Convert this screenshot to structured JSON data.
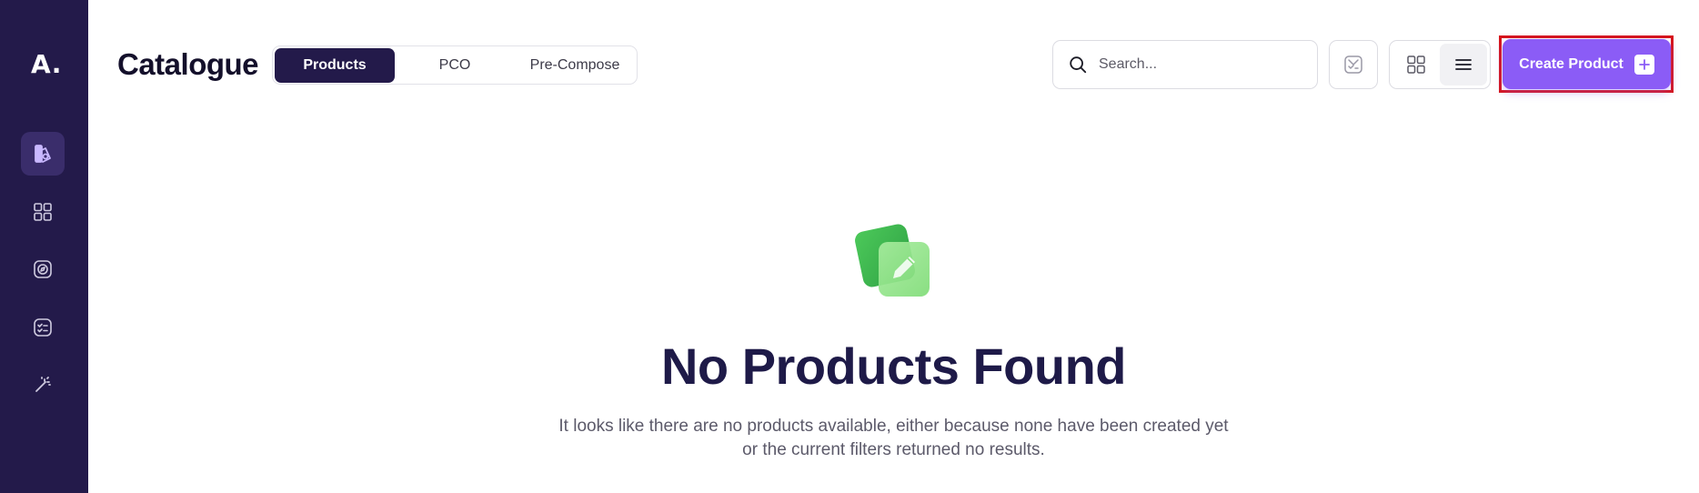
{
  "app": {
    "logo_text": "A."
  },
  "sidebar": {
    "items": [
      {
        "icon": "catalogue-icon",
        "active": true
      },
      {
        "icon": "grid-icon",
        "active": false
      },
      {
        "icon": "compass-icon",
        "active": false
      },
      {
        "icon": "checklist-icon",
        "active": false
      },
      {
        "icon": "magic-wand-icon",
        "active": false
      }
    ]
  },
  "header": {
    "title": "Catalogue",
    "tabs": [
      {
        "label": "Products",
        "active": true
      },
      {
        "label": "PCO",
        "active": false
      },
      {
        "label": "Pre-Compose",
        "active": false
      }
    ],
    "search": {
      "placeholder": "Search...",
      "value": ""
    },
    "view_mode": "list",
    "create_button_label": "Create Product"
  },
  "empty_state": {
    "title": "No Products Found",
    "description_line1": "It looks like there are no products available, either because none have been created yet",
    "description_line2": "or the current filters returned no results."
  },
  "colors": {
    "sidebar_bg": "#231a4a",
    "active_tab_bg": "#231a4a",
    "accent": "#8b5cf6",
    "highlight_outline": "#d7141a"
  }
}
